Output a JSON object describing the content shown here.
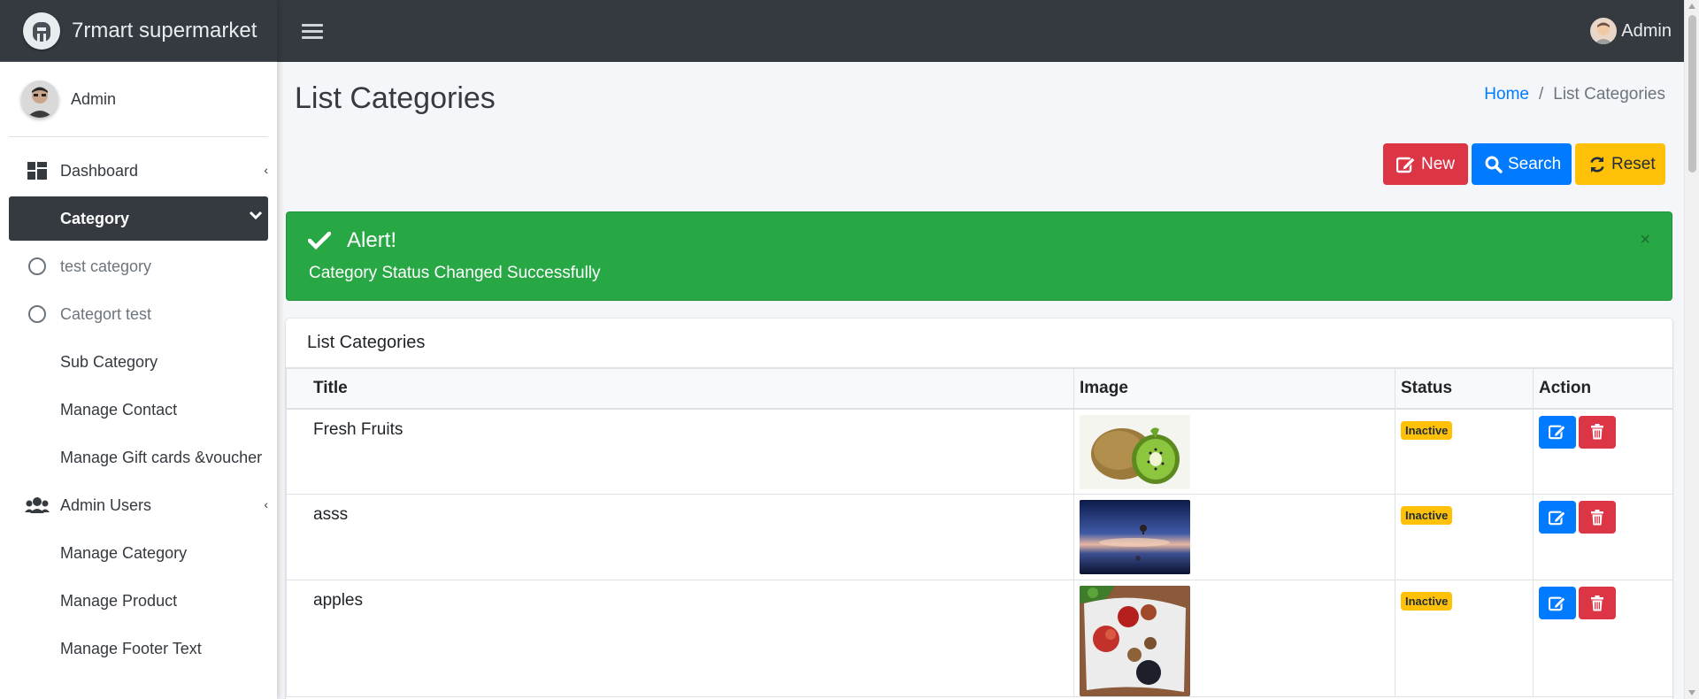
{
  "brand": {
    "name": "7rmart supermarket"
  },
  "navbar": {
    "user": "Admin"
  },
  "sidebar": {
    "user": "Admin",
    "items": [
      {
        "label": "Dashboard",
        "icon": "dashboard-icon",
        "caret": "‹"
      },
      {
        "label": "Category",
        "icon": "none",
        "caret": "⌄"
      },
      {
        "label": "test category",
        "icon": "circle-icon"
      },
      {
        "label": "Categort test",
        "icon": "circle-icon"
      },
      {
        "label": "Sub Category",
        "icon": "none"
      },
      {
        "label": "Manage Contact",
        "icon": "none"
      },
      {
        "label": "Manage Gift cards &voucher",
        "icon": "none"
      },
      {
        "label": "Admin Users",
        "icon": "users-icon",
        "caret": "‹"
      },
      {
        "label": "Manage Category",
        "icon": "none"
      },
      {
        "label": "Manage Product",
        "icon": "none"
      },
      {
        "label": "Manage Footer Text",
        "icon": "none"
      }
    ]
  },
  "page": {
    "title": "List Categories",
    "breadcrumb": {
      "home": "Home",
      "sep": "/",
      "current": "List Categories"
    }
  },
  "actions": {
    "new": "New",
    "search": "Search",
    "reset": "Reset"
  },
  "alert": {
    "title": "Alert!",
    "message": "Category Status Changed Successfully",
    "close": "×"
  },
  "table": {
    "title": "List Categories",
    "columns": [
      "Title",
      "Image",
      "Status",
      "Action"
    ],
    "rows": [
      {
        "title": "Fresh Fruits",
        "image": "kiwi-fruit-image",
        "status": "Inactive"
      },
      {
        "title": "asss",
        "image": "night-sky-balloon-image",
        "status": "Inactive"
      },
      {
        "title": "apples",
        "image": "apples-on-cloth-image",
        "status": "Inactive"
      }
    ]
  },
  "colors": {
    "dark": "#343a40",
    "primary": "#007bff",
    "danger": "#dc3545",
    "warning": "#ffc107",
    "success": "#28a745"
  }
}
